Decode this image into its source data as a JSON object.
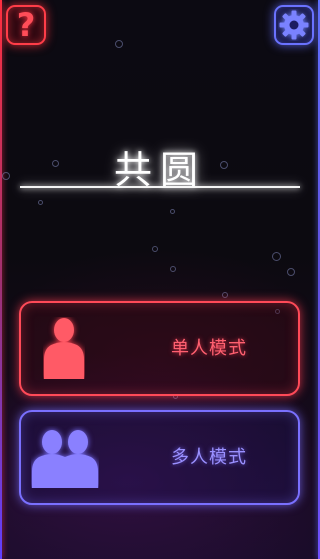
{
  "header": {
    "help_label": "?",
    "help_icon": "question-icon",
    "settings_icon": "gear-icon"
  },
  "title": "共圆",
  "modes": {
    "single": {
      "label": "单人模式",
      "icon": "person-icon"
    },
    "multi": {
      "label": "多人模式",
      "icon": "people-icon"
    }
  },
  "colors": {
    "red_accent": "#ff4a58",
    "blue_accent": "#7a70ff",
    "title_white": "#ffffff",
    "background": "#0c0a12"
  }
}
